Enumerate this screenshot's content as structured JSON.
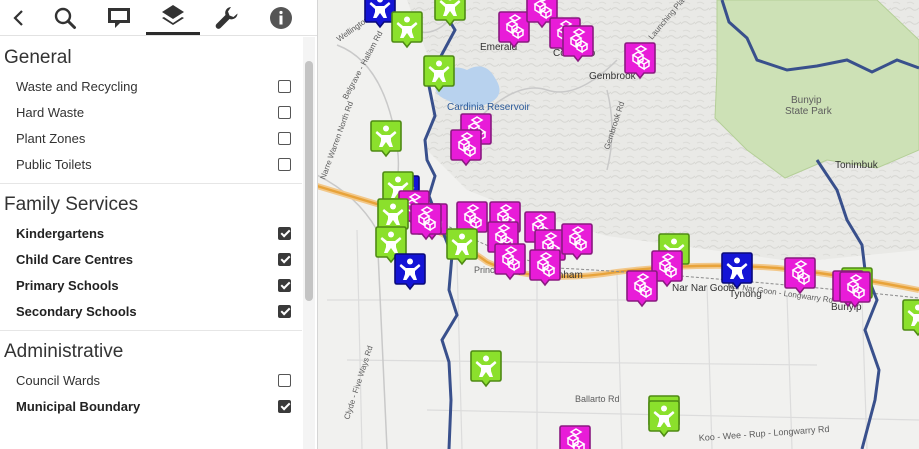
{
  "toolbar": {
    "tools": [
      {
        "icon": "back-icon"
      },
      {
        "icon": "search-icon"
      },
      {
        "icon": "comment-icon"
      },
      {
        "icon": "layers-icon",
        "active": true
      },
      {
        "icon": "wrench-icon"
      },
      {
        "icon": "info-icon"
      }
    ]
  },
  "layers": {
    "general": {
      "title": "General",
      "items": [
        {
          "label": "Waste and Recycling",
          "checked": false
        },
        {
          "label": "Hard Waste",
          "checked": false
        },
        {
          "label": "Plant Zones",
          "checked": false
        },
        {
          "label": "Public Toilets",
          "checked": false
        }
      ]
    },
    "family": {
      "title": "Family Services",
      "items": [
        {
          "label": "Kindergartens",
          "checked": true
        },
        {
          "label": "Child Care Centres",
          "checked": true
        },
        {
          "label": "Primary Schools",
          "checked": true
        },
        {
          "label": "Secondary Schools",
          "checked": true
        }
      ]
    },
    "admin": {
      "title": "Administrative",
      "items": [
        {
          "label": "Council Wards",
          "checked": false
        },
        {
          "label": "Municipal Boundary",
          "checked": true
        }
      ]
    }
  },
  "map": {
    "colors": {
      "kindergarten": "#8be02c",
      "childcare": "#e81cd8",
      "school": "#1414d6",
      "boundary": "#39508c",
      "park": "#cde1b6",
      "water": "#b8d2ee",
      "highway": "#e8a33a"
    },
    "place_labels": [
      {
        "text": "Emerald",
        "kind": "town"
      },
      {
        "text": "Cockatoo",
        "kind": "town"
      },
      {
        "text": "Gembrook",
        "kind": "town"
      },
      {
        "text": "Cardinia Reservoir",
        "kind": "water"
      },
      {
        "text": "Bunyip",
        "kind": "park"
      },
      {
        "text": "State Park",
        "kind": "park"
      },
      {
        "text": "Tonimbuk",
        "kind": "town"
      },
      {
        "text": "Nar Nar Goon",
        "kind": "town"
      },
      {
        "text": "Tynong",
        "kind": "town"
      },
      {
        "text": "Bunyip",
        "kind": "town"
      },
      {
        "text": "Pakenham",
        "kind": "town"
      },
      {
        "text": "Princes Fwy",
        "kind": "road"
      },
      {
        "text": "Wellington Rd",
        "kind": "road"
      },
      {
        "text": "Belgrave - Hallam Rd",
        "kind": "road"
      },
      {
        "text": "Narre Warren North Rd",
        "kind": "road"
      },
      {
        "text": "Ballarto Rd",
        "kind": "road"
      },
      {
        "text": "Koo - Wee - Rup - Longwarry Rd",
        "kind": "road"
      },
      {
        "text": "Clyde - Five Ways Rd",
        "kind": "road"
      },
      {
        "text": "Gembrook Rd",
        "kind": "road"
      },
      {
        "text": "Nar Nar Goon - Longwarry Rd",
        "kind": "road"
      },
      {
        "text": "Launching Place Rd",
        "kind": "road"
      }
    ],
    "markers": [
      {
        "type": "school"
      },
      {
        "type": "kindergarten"
      },
      {
        "type": "kindergarten"
      },
      {
        "type": "childcare"
      },
      {
        "type": "childcare"
      },
      {
        "type": "childcare"
      },
      {
        "type": "childcare"
      },
      {
        "type": "kindergarten"
      },
      {
        "type": "childcare"
      },
      {
        "type": "kindergarten"
      },
      {
        "type": "childcare"
      },
      {
        "type": "childcare"
      },
      {
        "type": "school"
      },
      {
        "type": "kindergarten"
      },
      {
        "type": "childcare"
      },
      {
        "type": "childcare"
      },
      {
        "type": "kindergarten"
      },
      {
        "type": "kindergarten"
      },
      {
        "type": "childcare"
      },
      {
        "type": "childcare"
      },
      {
        "type": "childcare"
      },
      {
        "type": "kindergarten"
      },
      {
        "type": "childcare"
      },
      {
        "type": "childcare"
      },
      {
        "type": "childcare"
      },
      {
        "type": "childcare"
      },
      {
        "type": "school"
      },
      {
        "type": "childcare"
      },
      {
        "type": "childcare"
      },
      {
        "type": "kindergarten"
      },
      {
        "type": "childcare"
      },
      {
        "type": "school"
      },
      {
        "type": "childcare"
      },
      {
        "type": "childcare"
      },
      {
        "type": "kindergarten"
      },
      {
        "type": "kindergarten"
      },
      {
        "type": "childcare"
      },
      {
        "type": "childcare"
      },
      {
        "type": "kindergarten"
      },
      {
        "type": "kindergarten"
      },
      {
        "type": "kindergarten"
      },
      {
        "type": "childcare"
      }
    ]
  }
}
